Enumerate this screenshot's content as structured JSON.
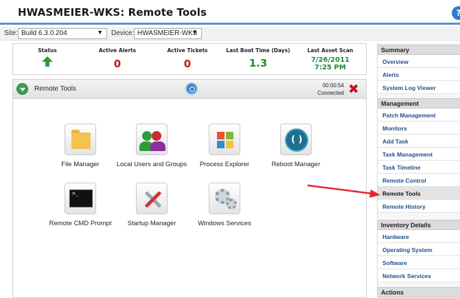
{
  "window": {
    "title": "HWASMEIER-WKS: Remote Tools"
  },
  "filters": {
    "site_label": "Site:",
    "site_value": "Build 6.3.0.204",
    "device_label": "Device:",
    "device_value": "HWASMEIER-WKS"
  },
  "stats": {
    "status_label": "Status",
    "active_alerts_label": "Active Alerts",
    "active_alerts_value": "0",
    "active_tickets_label": "Active Tickets",
    "active_tickets_value": "0",
    "last_boot_label": "Last Boot Time (Days)",
    "last_boot_value": "1.3",
    "last_scan_label": "Last Asset Scan",
    "last_scan_date": "7/26/2011",
    "last_scan_time": "7:25 PM"
  },
  "panel": {
    "title": "Remote Tools",
    "timer": "00:00:54",
    "connection_status": "Connected"
  },
  "tools": [
    {
      "label": "File Manager",
      "icon": "file-manager-icon"
    },
    {
      "label": "Local Users and Groups",
      "icon": "users-groups-icon"
    },
    {
      "label": "Process Explorer",
      "icon": "process-explorer-icon"
    },
    {
      "label": "Reboot Manager",
      "icon": "reboot-icon"
    },
    {
      "label": "Remote CMD Prompt",
      "icon": "cmd-prompt-icon"
    },
    {
      "label": "Startup Manager",
      "icon": "startup-manager-icon"
    },
    {
      "label": "Windows Services",
      "icon": "services-gear-icon"
    }
  ],
  "cmd_prompt_glyph": ">_",
  "sidebar": {
    "summary_title": "Summary",
    "summary_items": [
      "Overview",
      "Alerts",
      "System Log Viewer"
    ],
    "management_title": "Management",
    "management_items": [
      "Patch Management",
      "Monitors",
      "Add Task",
      "Task Management",
      "Task Timeline",
      "Remote Control",
      "Remote Tools",
      "Remote History"
    ],
    "active_item": "Remote Tools",
    "inventory_title": "Inventory Details",
    "inventory_items": [
      "Hardware",
      "Operating System",
      "Software",
      "Network Services"
    ],
    "actions_title": "Actions"
  },
  "colors": {
    "accent_blue": "#5b8fc4",
    "alert_red": "#c0171c",
    "ok_green": "#1e8a2e",
    "link_blue": "#1f4f87",
    "annotation_arrow": "#e3262b"
  }
}
